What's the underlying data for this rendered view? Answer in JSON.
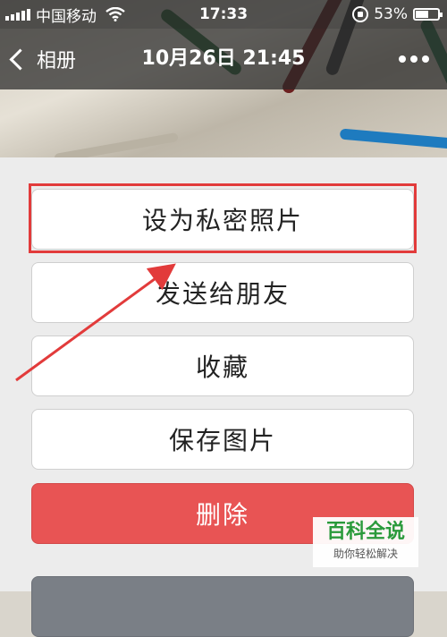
{
  "status_bar": {
    "carrier": "中国移动",
    "time": "17:33",
    "battery": "53%",
    "battery_level": 0.53,
    "icons": [
      "signal-icon",
      "wifi-icon",
      "rotation-lock-icon",
      "battery-icon"
    ]
  },
  "nav": {
    "back_label": "相册",
    "title": "10月26日 21:45",
    "more_icon": "more-dots-icon"
  },
  "action_sheet": {
    "items": [
      {
        "label": "设为私密照片"
      },
      {
        "label": "发送给朋友"
      },
      {
        "label": "收藏"
      },
      {
        "label": "保存图片"
      },
      {
        "label": "删除"
      }
    ]
  },
  "annotation": {
    "highlight_color": "#e23b3b",
    "arrow_color": "#e23b3b"
  },
  "watermark": {
    "title": "百科全说",
    "subtitle": "助你轻松解决"
  },
  "colors": {
    "delete": "#e85454",
    "sheet_bg": "#ececec",
    "watermark_green": "#2a9a3b"
  }
}
